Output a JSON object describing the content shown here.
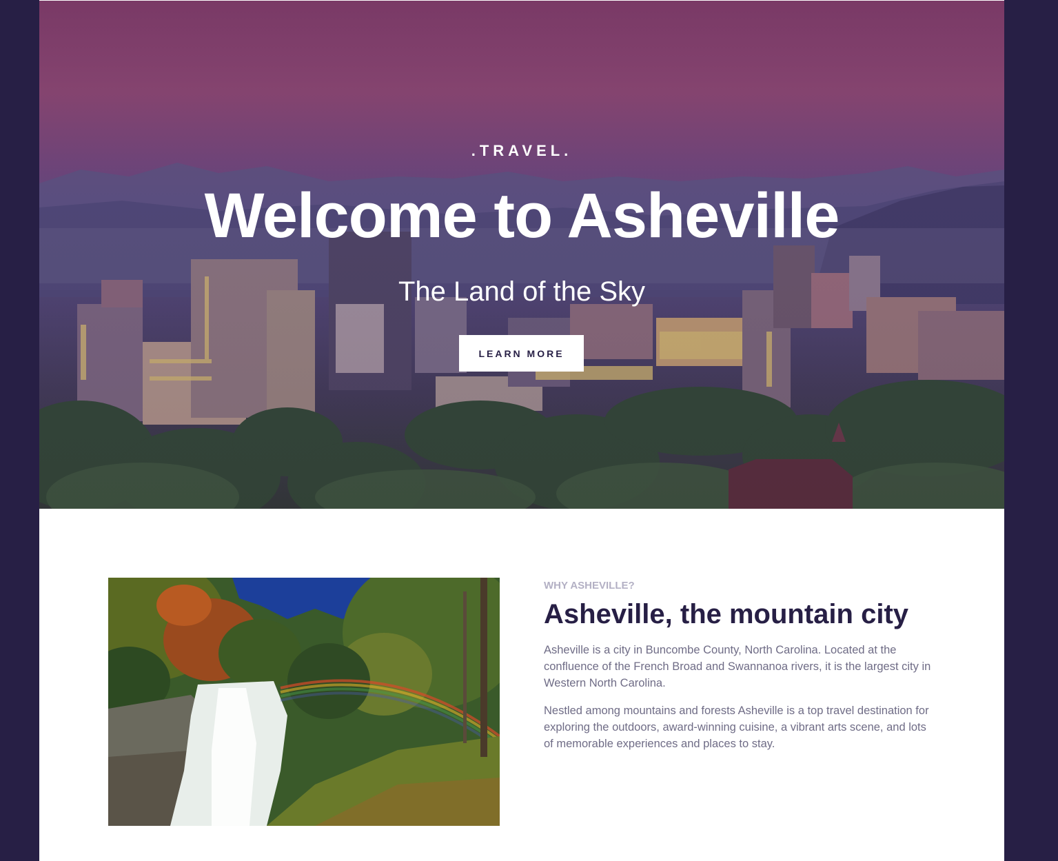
{
  "hero": {
    "eyebrow": ".TRAVEL.",
    "title": "Welcome to Asheville",
    "subtitle": "The Land of the Sky",
    "cta_label": "LEARN MORE"
  },
  "about": {
    "kicker": "WHY ASHEVILLE?",
    "title": "Asheville, the mountain city",
    "paragraphs": [
      "Asheville is a city in Buncombe County, North Carolina. Located at the confluence of the French Broad and Swannanoa rivers, it is the largest city in Western North Carolina.",
      "Nestled among mountains and forests Asheville is a top travel destination for exploring the outdoors, award-winning cuisine, a vibrant arts scene, and lots of memorable experiences and places to stay."
    ]
  },
  "colors": {
    "frame_bg": "#271f45",
    "heading": "#271f45",
    "body_text": "#6f6c86",
    "kicker": "#b3b0c4"
  }
}
